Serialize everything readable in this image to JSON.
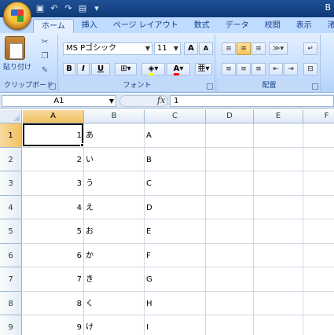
{
  "title_fragment": "B",
  "tabs": [
    "ホーム",
    "挿入",
    "ページ レイアウト",
    "数式",
    "データ",
    "校閲",
    "表示",
    "渚"
  ],
  "ribbon": {
    "clipboard": {
      "paste_label": "貼り付け",
      "group_label": "クリップボード"
    },
    "font": {
      "font_name": "MS Pゴシック",
      "font_size": "11",
      "bold": "B",
      "italic": "I",
      "underline": "U",
      "grow": "A",
      "shrink": "A",
      "color": "A",
      "group_label": "フォント"
    },
    "alignment": {
      "group_label": "配置"
    }
  },
  "formula_bar": {
    "name_box": "A1",
    "fx": "fx",
    "value": "1"
  },
  "columns": [
    "A",
    "B",
    "C",
    "D",
    "E",
    "F"
  ],
  "selected_column": "A",
  "selected_row": "1",
  "rows": [
    {
      "n": "1",
      "a": "1",
      "b": "あ",
      "c": "A"
    },
    {
      "n": "2",
      "a": "2",
      "b": "い",
      "c": "B"
    },
    {
      "n": "3",
      "a": "3",
      "b": "う",
      "c": "C"
    },
    {
      "n": "4",
      "a": "4",
      "b": "え",
      "c": "D"
    },
    {
      "n": "5",
      "a": "5",
      "b": "お",
      "c": "E"
    },
    {
      "n": "6",
      "a": "6",
      "b": "か",
      "c": "F"
    },
    {
      "n": "7",
      "a": "7",
      "b": "き",
      "c": "G"
    },
    {
      "n": "8",
      "a": "8",
      "b": "く",
      "c": "H"
    },
    {
      "n": "9",
      "a": "9",
      "b": "け",
      "c": "I"
    }
  ]
}
